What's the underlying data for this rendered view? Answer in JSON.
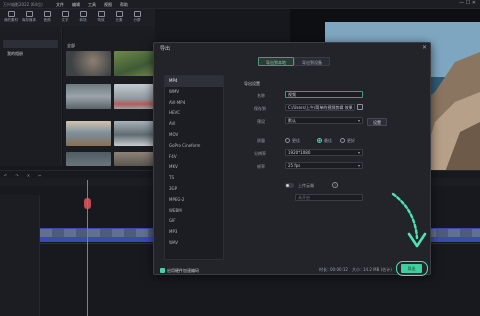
{
  "app": {
    "title": "万兴喵影2022 (64位)",
    "menu": [
      "文件",
      "编辑",
      "工具",
      "视图",
      "帮助"
    ]
  },
  "toolbar": [
    {
      "label": "我的素材",
      "icon": "folder-icon"
    },
    {
      "label": "库存媒体",
      "icon": "stock-icon"
    },
    {
      "label": "音频",
      "icon": "music-icon"
    },
    {
      "label": "文字",
      "icon": "text-icon"
    },
    {
      "label": "转场",
      "icon": "transition-icon"
    },
    {
      "label": "特效",
      "icon": "effects-icon"
    },
    {
      "label": "元素",
      "icon": "elements-icon"
    },
    {
      "label": "分屏",
      "icon": "split-icon"
    }
  ],
  "sidebar": {
    "items": [
      "",
      "我的相册",
      "",
      "",
      "",
      ""
    ]
  },
  "media": {
    "header": "全部",
    "thumbs": [
      {
        "caption": "",
        "color": "#59646a"
      },
      {
        "caption": "",
        "color": "#5f6d4c"
      },
      {
        "caption": "",
        "color": "#7c8a92"
      },
      {
        "caption": "",
        "color": "#a6b0b6"
      },
      {
        "caption": "",
        "color": "#7d6d5f"
      },
      {
        "caption": "",
        "color": "#9aa5ac"
      },
      {
        "caption": "",
        "color": "#5d6a70"
      },
      {
        "caption": "",
        "color": "#8f8577"
      }
    ]
  },
  "dialog": {
    "title": "导出",
    "tabs": {
      "local": "导出到本地",
      "device": "导出到设备"
    },
    "formats": [
      "MP4",
      "WMV",
      "AVI-MP4",
      "HEVC",
      "AVI",
      "MOV",
      "GoPro Cineform",
      "F4V",
      "MKV",
      "TS",
      "3GP",
      "MPEG-2",
      "WEBM",
      "GIF",
      "MP3",
      "WAV"
    ],
    "selected_format": "MP4",
    "section_export": "导出设置",
    "name_label": "名称",
    "name_value": "视频",
    "save_label": "保存到",
    "save_value": "C:/Users/上午/简单的视频剪辑 效果",
    "preset_label": "预设",
    "preset_value": "默认",
    "settings_button": "设置",
    "quality_label": "质量",
    "quality_options": [
      "更佳",
      "最佳",
      "更好"
    ],
    "resolution_label": "分辨率",
    "resolution_value": "1920*1080",
    "framerate_label": "帧率",
    "framerate_value": "25 fps",
    "upload_label": "上传云端",
    "upload_placeholder": "未开启",
    "gpu_label": "启用硬件加速编码",
    "duration_label": "时长：",
    "duration_value": "00:00:12",
    "size_label": "大小：",
    "size_value": "14.2 MB (估计)",
    "export_button": "导出"
  },
  "colors": {
    "accent": "#3fcf9f",
    "track": "#3a4bb0",
    "playhead": "#e0555e"
  }
}
